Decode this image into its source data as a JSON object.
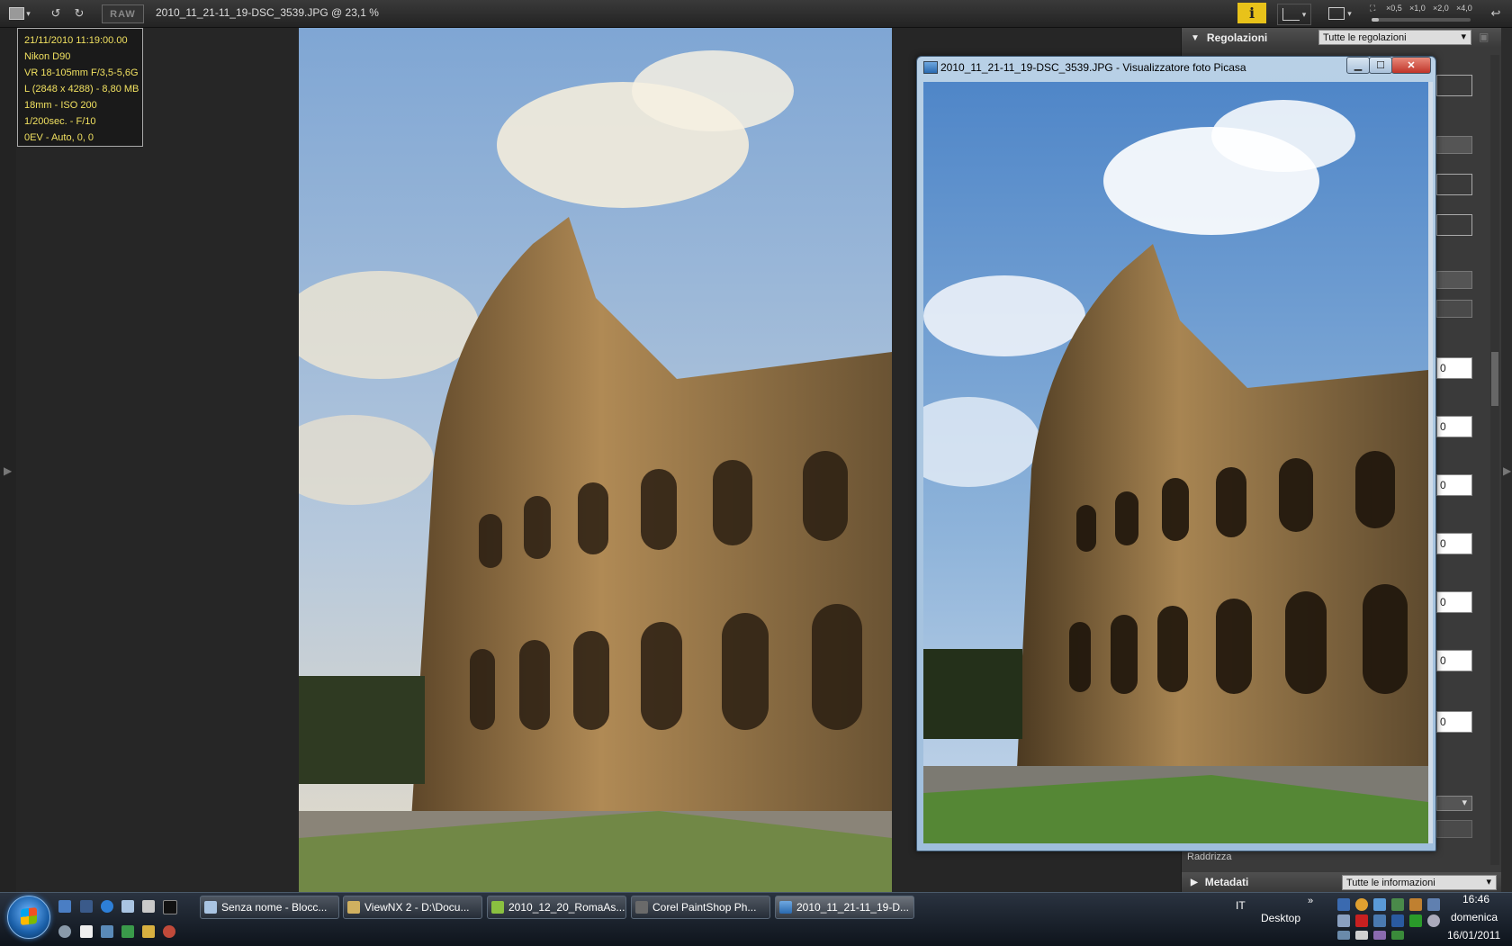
{
  "toolbar": {
    "file_title": "2010_11_21-11_19-DSC_3539.JPG @ 23,1 %",
    "raw_label": "RAW",
    "info_label": "i",
    "zoom_levels": [
      "×0,5",
      "×1,0",
      "×2,0",
      "×4,0"
    ]
  },
  "exif": {
    "lines": [
      "21/11/2010 11:19:00.00",
      "Nikon D90",
      "VR 18-105mm F/3,5-5,6G",
      "L (2848 x 4288) - 8,80 MB",
      "18mm - ISO 200",
      "1/200sec. - F/10",
      "0EV - Auto, 0, 0"
    ]
  },
  "right_panel": {
    "regolazioni_label": "Regolazioni",
    "regolazioni_select": "Tutte le regolazioni",
    "input_values": [
      "0",
      "0",
      "0",
      "0",
      "0",
      "0",
      "0"
    ],
    "raddrizza_label": "Raddrizza",
    "metadati_label": "Metadati",
    "metadati_select": "Tutte le informazioni"
  },
  "picasa": {
    "title": "2010_11_21-11_19-DSC_3539.JPG - Visualizzatore foto Picasa"
  },
  "taskbar": {
    "tasks": [
      "Senza nome - Blocc...",
      "ViewNX 2 - D:\\Docu...",
      "2010_12_20_RomaAs...",
      "Corel PaintShop Ph...",
      "2010_11_21-11_19-D..."
    ],
    "language": "IT",
    "desktop_label": "Desktop",
    "time": "16:46",
    "day": "domenica",
    "date": "16/01/2011"
  },
  "colors": {
    "exif_text": "#f0e060",
    "info_button": "#e8c21a",
    "sky": "#8fb4da"
  }
}
